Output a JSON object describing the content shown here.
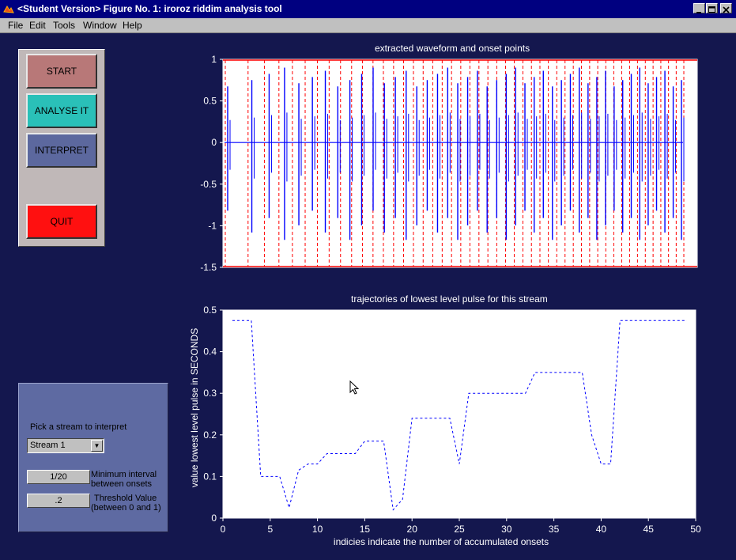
{
  "window": {
    "title": "<Student Version> Figure No. 1: iroroz riddim analysis tool",
    "minimize_icon": "minimize-icon",
    "maximize_icon": "maximize-icon",
    "close_icon": "close-icon"
  },
  "menu": {
    "items": [
      "File",
      "Edit",
      "Tools",
      "Window",
      "Help"
    ]
  },
  "controls": {
    "start_label": "START",
    "analyse_label": "ANALYSE IT",
    "interpret_label": "INTERPRET",
    "quit_label": "QUIT",
    "colors": {
      "start": "#b87878",
      "analyse": "#2ac0b8",
      "interpret": "#5c689e",
      "quit": "#ff1010"
    }
  },
  "stream_panel": {
    "pick_label": "Pick a stream to interpret",
    "stream_selected": "Stream 1",
    "min_interval_value": "1/20",
    "min_interval_label_line1": "Minimum interval",
    "min_interval_label_line2": "between onsets",
    "threshold_value": ".2",
    "threshold_label_line1": "Threshold Value",
    "threshold_label_line2": "(between 0 and 1)"
  },
  "chart_data": [
    {
      "type": "line",
      "title": "extracted waveform and onset points",
      "ylim": [
        -1.5,
        1
      ],
      "yticks": [
        "1",
        "0.5",
        "0",
        "-0.5",
        "-1",
        "-1.5"
      ],
      "ytick_values": [
        1,
        0.5,
        0,
        -0.5,
        -1,
        -1.5
      ],
      "grid": false,
      "series": [
        {
          "color": "#0000ff",
          "values": [
            0.9,
            0.9,
            0.9,
            0.9,
            0.9,
            0.9,
            0.9,
            0.9,
            0.9,
            0.9,
            0.9,
            0.9,
            0.9,
            0.9,
            0.9,
            0.9,
            0.9,
            0.9,
            0.9,
            0.9,
            0.9,
            0.9,
            0.9,
            0.9,
            0.9,
            0.9,
            0.9,
            0.9,
            0.9,
            0.9,
            0.9,
            0.9,
            0.9,
            0.9,
            0.9,
            0.9,
            0.9,
            0.9,
            0.9,
            0.9,
            0.9,
            0.9,
            0.9,
            0.9
          ]
        }
      ],
      "onset_color": "#ff0000",
      "onset_count": 48
    },
    {
      "type": "line",
      "title": "trajectories of lowest level pulse for this stream",
      "xlabel": "indicies indicate the number of accumulated onsets",
      "ylabel": "value lowest level pulse in SECONDS",
      "xlim": [
        0,
        50
      ],
      "ylim": [
        0,
        0.5
      ],
      "xticks": [
        0,
        5,
        10,
        15,
        20,
        25,
        30,
        35,
        40,
        45,
        50
      ],
      "yticks": [
        0,
        0.1,
        0.2,
        0.3,
        0.4,
        0.5
      ],
      "grid": false,
      "series": [
        {
          "color": "#0000ff",
          "style": "dashed",
          "x": [
            1,
            2,
            3,
            4,
            5,
            6,
            7,
            8,
            9,
            10,
            11,
            12,
            13,
            14,
            15,
            16,
            17,
            18,
            19,
            20,
            21,
            22,
            23,
            24,
            25,
            26,
            27,
            28,
            29,
            30,
            31,
            32,
            33,
            34,
            35,
            36,
            37,
            38,
            39,
            40,
            41,
            42,
            43,
            44,
            45,
            46,
            47,
            48,
            49
          ],
          "values": [
            0.475,
            0.475,
            0.475,
            0.1,
            0.1,
            0.1,
            0.025,
            0.115,
            0.13,
            0.13,
            0.155,
            0.155,
            0.155,
            0.155,
            0.185,
            0.185,
            0.185,
            0.02,
            0.045,
            0.24,
            0.24,
            0.24,
            0.24,
            0.24,
            0.13,
            0.3,
            0.3,
            0.3,
            0.3,
            0.3,
            0.3,
            0.3,
            0.35,
            0.35,
            0.35,
            0.35,
            0.35,
            0.35,
            0.2,
            0.13,
            0.13,
            0.475,
            0.475,
            0.475,
            0.475,
            0.475,
            0.475,
            0.475,
            0.475
          ]
        }
      ]
    }
  ],
  "cursor_icon": "mouse-pointer-icon"
}
